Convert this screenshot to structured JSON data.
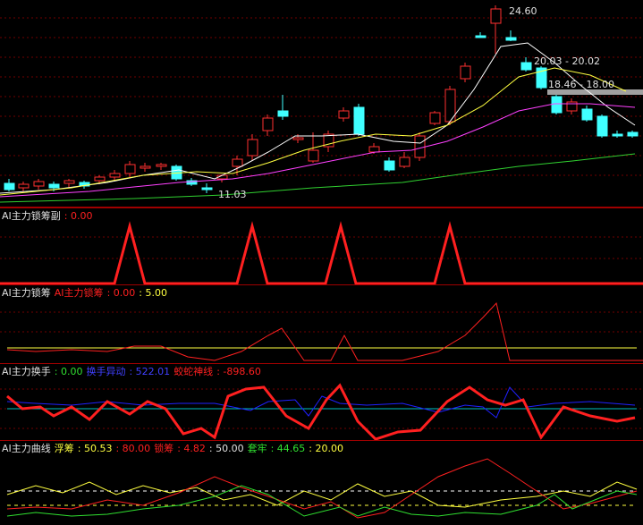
{
  "main_chart": {
    "high_label": "24.60",
    "low_label": "11.03",
    "ma_label_1": "20.03 - 20.02",
    "ma_label_2": "18.46 - 18.00"
  },
  "panel_lock_sub": {
    "title": "AI主力锁筹副",
    "value": ": 0.00"
  },
  "panel_lock": {
    "title": "AI主力锁筹",
    "series1_name": "AI主力锁筹",
    "series1_value": ": 0.00",
    "series2_value": ": 5.00"
  },
  "panel_turnover": {
    "title": "AI主力换手",
    "value0": ": 0.00",
    "series1_name": "换手异动",
    "series1_value": ": 522.01",
    "series2_name": "蛟蛇神线",
    "series2_value": ": -898.60"
  },
  "panel_curve": {
    "title": "AI主力曲线",
    "float_name": "浮筹",
    "float_value": ": 50.53",
    "v80": ": 80.00",
    "lock_name": "锁筹",
    "lock_value": ": 4.82",
    "v50": ": 50.00",
    "trap_name": "套牢",
    "trap_value": ": 44.65",
    "v20": ": 20.00"
  },
  "colors": {
    "up": "#ff3030",
    "down": "#40ffff",
    "ma_white": "#ffffff",
    "ma_yellow": "#ffff40",
    "ma_magenta": "#ff40ff",
    "ma_green": "#30d030"
  }
}
